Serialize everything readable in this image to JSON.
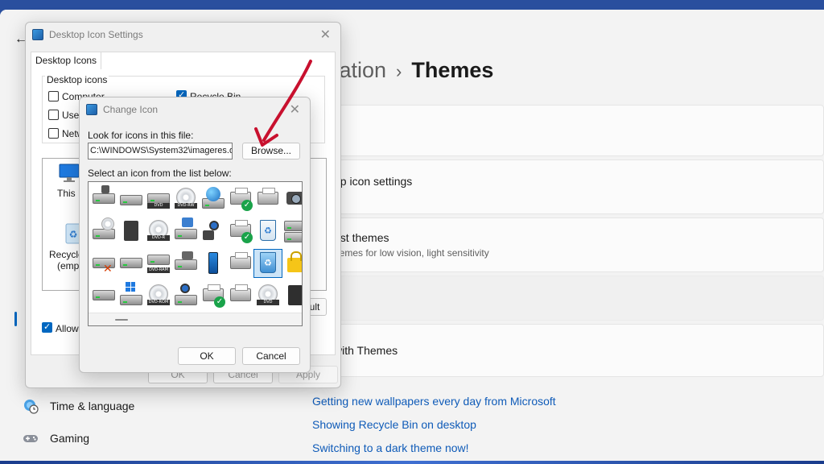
{
  "settings": {
    "breadcrumb_parent": "lization",
    "breadcrumb_separator": "›",
    "breadcrumb_current": "Themes",
    "cards": [
      {
        "title": "s",
        "subtitle": ""
      },
      {
        "title": "op icon settings",
        "subtitle": ""
      },
      {
        "title": "ast themes",
        "subtitle": "hemes for low vision, light sensitivity"
      },
      {
        "title": "t",
        "subtitle": ""
      },
      {
        "title": "with Themes",
        "subtitle": ""
      }
    ],
    "links": [
      "Getting new wallpapers every day from Microsoft",
      "Showing Recycle Bin on desktop",
      "Switching to a dark theme now!"
    ],
    "nav": [
      {
        "label": "Time & language",
        "icon": "globe-clock-icon"
      },
      {
        "label": "Gaming",
        "icon": "gamepad-icon"
      }
    ]
  },
  "desktop_icon_settings": {
    "title": "Desktop Icon Settings",
    "tab": "Desktop Icons",
    "group_label": "Desktop icons",
    "checkboxes": [
      {
        "label": "Computer",
        "checked": false
      },
      {
        "label": "User",
        "checked": false
      },
      {
        "label": "Netw",
        "checked": false
      },
      {
        "label": "Recycle Bin",
        "checked": true
      }
    ],
    "icons": [
      {
        "label": "This P"
      },
      {
        "label": "Recycle"
      },
      {
        "label": "(empt"
      }
    ],
    "restore_default_label": "ult",
    "allow_label": "Allow t",
    "allow_checked": true,
    "ok_label": "OK",
    "cancel_label": "Cancel",
    "apply_label": "Apply"
  },
  "change_icon": {
    "title": "Change Icon",
    "look_label": "Look for icons in this file:",
    "path_value": "C:\\WINDOWS\\System32\\imageres.dll",
    "browse_label": "Browse...",
    "list_label": "Select an icon from the list below:",
    "disc_labels": [
      "DVD",
      "DVD-RW",
      "DVD-R",
      "DVD-RAM",
      "DVD-ROM",
      "DVD"
    ],
    "ok_label": "OK",
    "cancel_label": "Cancel"
  },
  "colors": {
    "accent": "#0067c0",
    "link": "#0f5bb8",
    "annotation_arrow": "#c8102e"
  }
}
